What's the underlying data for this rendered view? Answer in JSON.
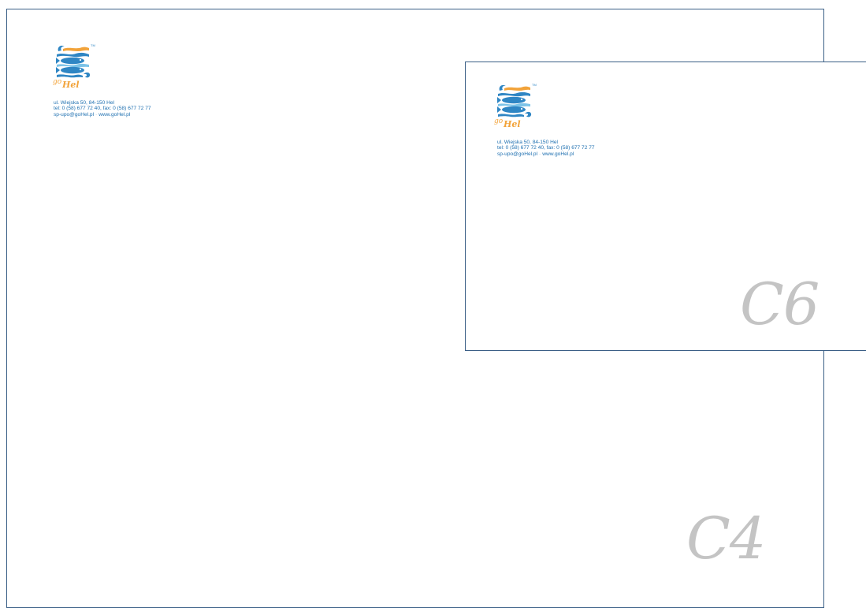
{
  "envelopes": [
    {
      "size_label": "C4",
      "logo": {
        "icon": "gohel-fish-waves-logo",
        "wordmark_go": "go",
        "wordmark_hel": "Hel",
        "trademark": "TM"
      },
      "address": {
        "line1": "ul. Wiejska 50, 84-150 Hel",
        "line2": "tel: 0 (58) 677 72 40, fax: 0 (58) 677 72 77",
        "email": "sp-upo@goHel.pl",
        "website": "www.goHel.pl"
      }
    },
    {
      "size_label": "C6",
      "logo": {
        "icon": "gohel-fish-waves-logo",
        "wordmark_go": "go",
        "wordmark_hel": "Hel",
        "trademark": "TM"
      },
      "address": {
        "line1": "ul. Wiejska 50, 84-150 Hel",
        "line2": "tel: 0 (58) 677 72 40, fax: 0 (58) 677 72 77",
        "email": "sp-upo@goHel.pl",
        "website": "www.goHel.pl"
      }
    }
  ],
  "colors": {
    "border": "#3a5f86",
    "address_text": "#1d6fb0",
    "size_label": "#c4c4c4",
    "logo_blue": "#2f86c4",
    "logo_light_blue": "#7cc3e8",
    "logo_orange": "#f2a33a"
  }
}
